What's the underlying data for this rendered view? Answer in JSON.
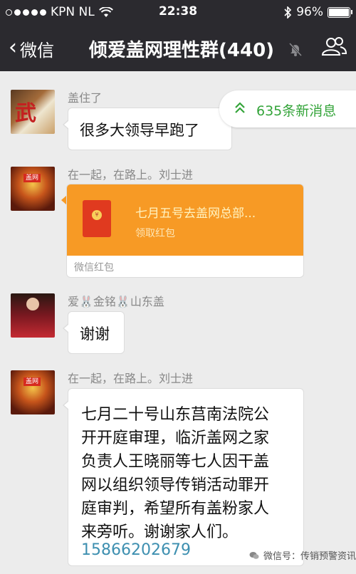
{
  "status_bar": {
    "carrier": "KPN NL",
    "time": "22:38",
    "battery": "96%"
  },
  "nav": {
    "back_label": "微信",
    "title": "倾爱盖网理性群(440)"
  },
  "new_messages": {
    "label": "635条新消息"
  },
  "messages": [
    {
      "sender": "盖住了",
      "text": "很多大领导早跑了"
    },
    {
      "sender": "在一起，在路上。刘士进",
      "red_packet": {
        "title": "七月五号去盖网总部...",
        "action": "领取红包",
        "footer": "微信红包"
      }
    },
    {
      "sender": "爱🐰金铭🐰山东盖",
      "text": "谢谢"
    },
    {
      "sender": "在一起，在路上。刘士进",
      "lines": [
        "七月二十号山东莒南法院公",
        "开开庭审理，临沂盖网之家",
        "负责人王晓丽等七人因干盖",
        "网以组织领导传销活动罪开",
        "庭审判，希望所有盖粉家人",
        "来旁听。谢谢家人们。"
      ],
      "phone": "15866202679"
    }
  ],
  "watermark": "微信号：传销预警资讯",
  "avatar_text": {
    "gaiwang": "盖网",
    "wu": "武"
  },
  "colors": {
    "header_bg": "#2b2a2f",
    "chat_bg": "#ececec",
    "red_packet": "#f79a25",
    "new_msg_green": "#34a43a",
    "link_blue": "#3d8fb0"
  }
}
